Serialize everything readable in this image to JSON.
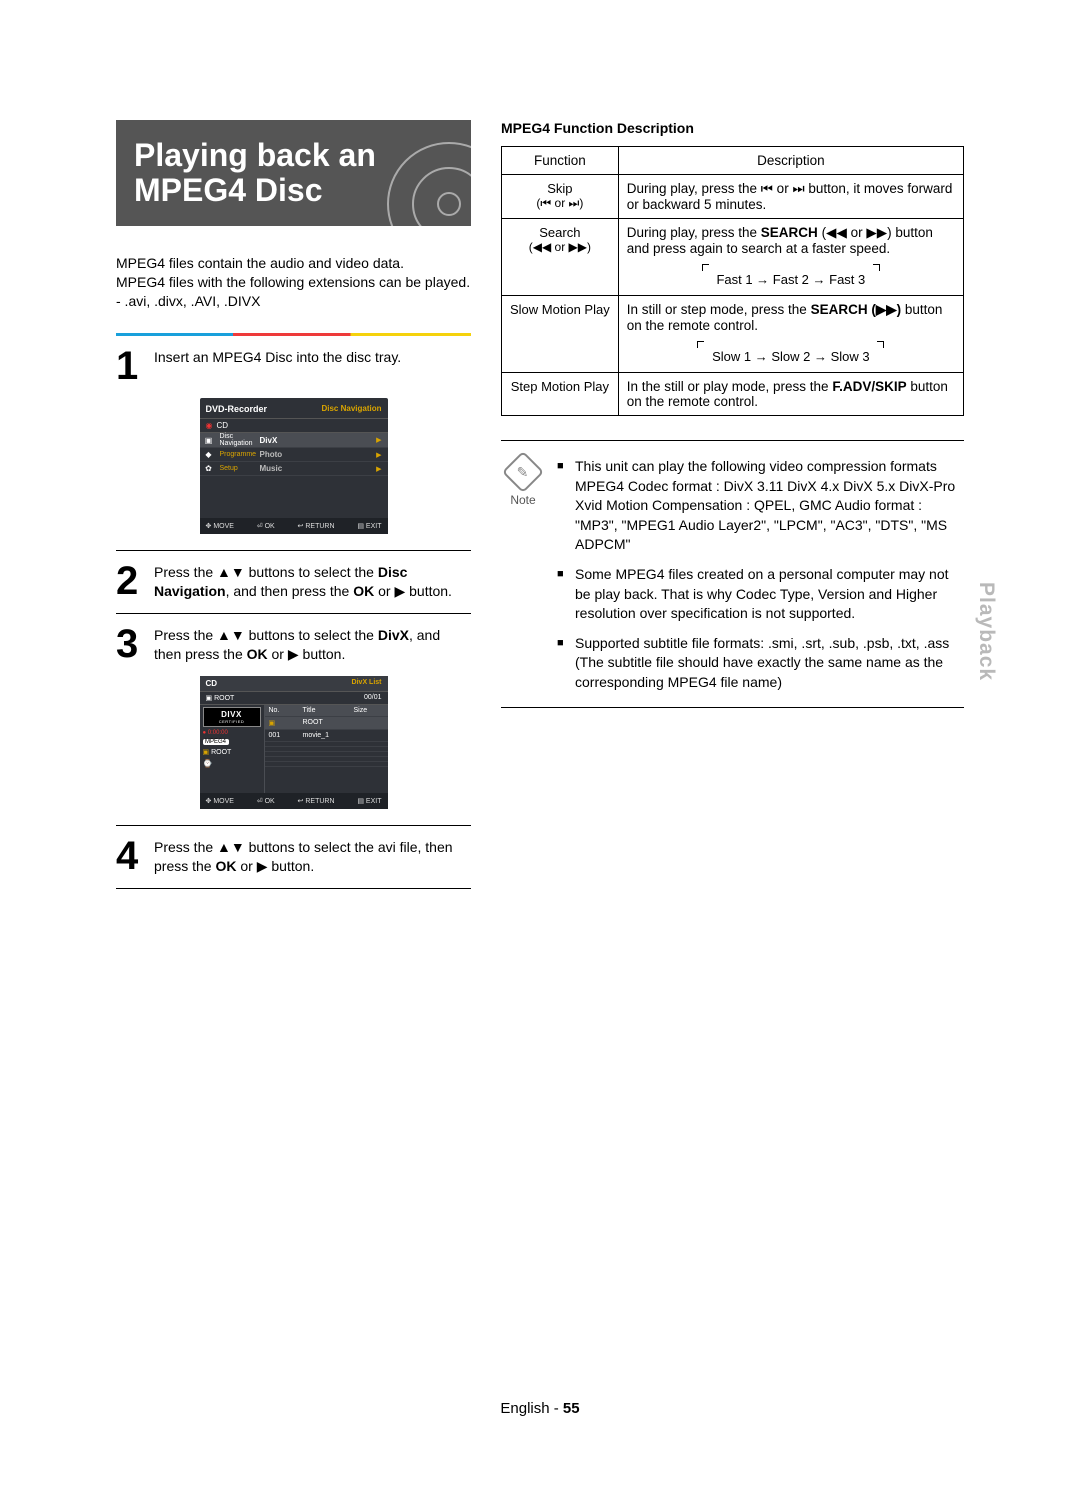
{
  "title_line1": "Playing back an",
  "title_line2": "MPEG4 Disc",
  "intro": {
    "l1": "MPEG4 files contain the audio and video data.",
    "l2": "MPEG4 files with the following extensions can be played.",
    "l3": "- .avi, .divx, .AVI, .DIVX"
  },
  "steps": {
    "s1": "Insert an MPEG4 Disc into the disc tray.",
    "s2_a": "Press the ",
    "s2_b": " buttons to select the ",
    "s2_bold1": "Disc Navigation",
    "s2_c": ", and then press the ",
    "s2_bold2": "OK",
    "s2_d": " or ",
    "s2_e": " button.",
    "s3_a": "Press the ",
    "s3_b": " buttons to select the ",
    "s3_bold1": "DivX",
    "s3_c": ", and then press the ",
    "s3_bold2": "OK",
    "s3_d": " or ",
    "s3_e": " button.",
    "s4_a": "Press the ",
    "s4_b": " buttons to select the avi file, then press the ",
    "s4_bold": "OK",
    "s4_c": " or ",
    "s4_d": " button."
  },
  "screen1": {
    "title": "DVD-Recorder",
    "top_right": "Disc Navigation",
    "cd": "CD",
    "items": [
      {
        "left": "Disc Navigation",
        "right": "DivX",
        "sel": true
      },
      {
        "left": "Programme",
        "right": "Photo",
        "sel": false
      },
      {
        "left": "Setup",
        "right": "Music",
        "sel": false
      }
    ],
    "footer": {
      "move": "MOVE",
      "ok": "OK",
      "return": "RETURN",
      "exit": "EXIT"
    }
  },
  "screen2": {
    "cd": "CD",
    "top_right": "DivX List",
    "root": "ROOT",
    "count": "00/01",
    "thead": {
      "no": "No.",
      "title": "Title",
      "size": "Size"
    },
    "rows": [
      {
        "no": "",
        "title": "ROOT",
        "sel": true
      },
      {
        "no": "001",
        "title": "movie_1",
        "sel": false
      }
    ],
    "time": "0:00:00",
    "mpeg4": "MPEG4",
    "divx_l1": "DIVX",
    "divx_l2": "CERTIFIED",
    "footer": {
      "move": "MOVE",
      "ok": "OK",
      "return": "RETURN",
      "exit": "EXIT"
    }
  },
  "func_title": "MPEG4 Function Description",
  "func_table": {
    "h1": "Function",
    "h2": "Description",
    "rows": [
      {
        "fn": "Skip",
        "fn2": "(⏮ or ⏭)",
        "desc": "During play, press the ⏮ or ⏭ button, it moves forward or backward 5 minutes."
      },
      {
        "fn": "Search",
        "fn2": "(◀◀ or ▶▶)",
        "desc_a": "During play, press the ",
        "desc_bold": "SEARCH",
        "desc_b": " (◀◀ or ▶▶) button and press again to search at a faster speed.",
        "seq": "Fast 1 → Fast 2 → Fast 3"
      },
      {
        "fn": "Slow Motion Play",
        "desc_a": "In still or step mode, press the ",
        "desc_bold": "SEARCH (▶▶)",
        "desc_b": " button on the remote control.",
        "seq": "Slow 1 → Slow 2 → Slow 3"
      },
      {
        "fn": "Step Motion Play",
        "desc_a": "In the still or play mode, press the ",
        "desc_bold": "F.ADV/SKIP",
        "desc_b": " button on the remote control."
      }
    ]
  },
  "note": {
    "label": "Note",
    "items": [
      "This unit can play the following video compression formats MPEG4 Codec format : DivX 3.11 DivX 4.x DivX 5.x DivX-Pro Xvid Motion Compensation : QPEL, GMC Audio format : \"MP3\", \"MPEG1 Audio Layer2\", \"LPCM\", \"AC3\", \"DTS\", \"MS ADPCM\"",
      "Some MPEG4 files created on a personal computer may not be play back. That is why Codec Type, Version and Higher resolution over specification is not supported.",
      "Supported subtitle file formats: .smi, .srt, .sub, .psb, .txt, .ass (The subtitle file should have exactly the same name as the corresponding MPEG4 file name)"
    ]
  },
  "side_tab": "Playback",
  "footer": {
    "lang": "English",
    "sep": " - ",
    "page": "55"
  },
  "glyphs": {
    "updown": "▲▼",
    "play": "▶"
  }
}
